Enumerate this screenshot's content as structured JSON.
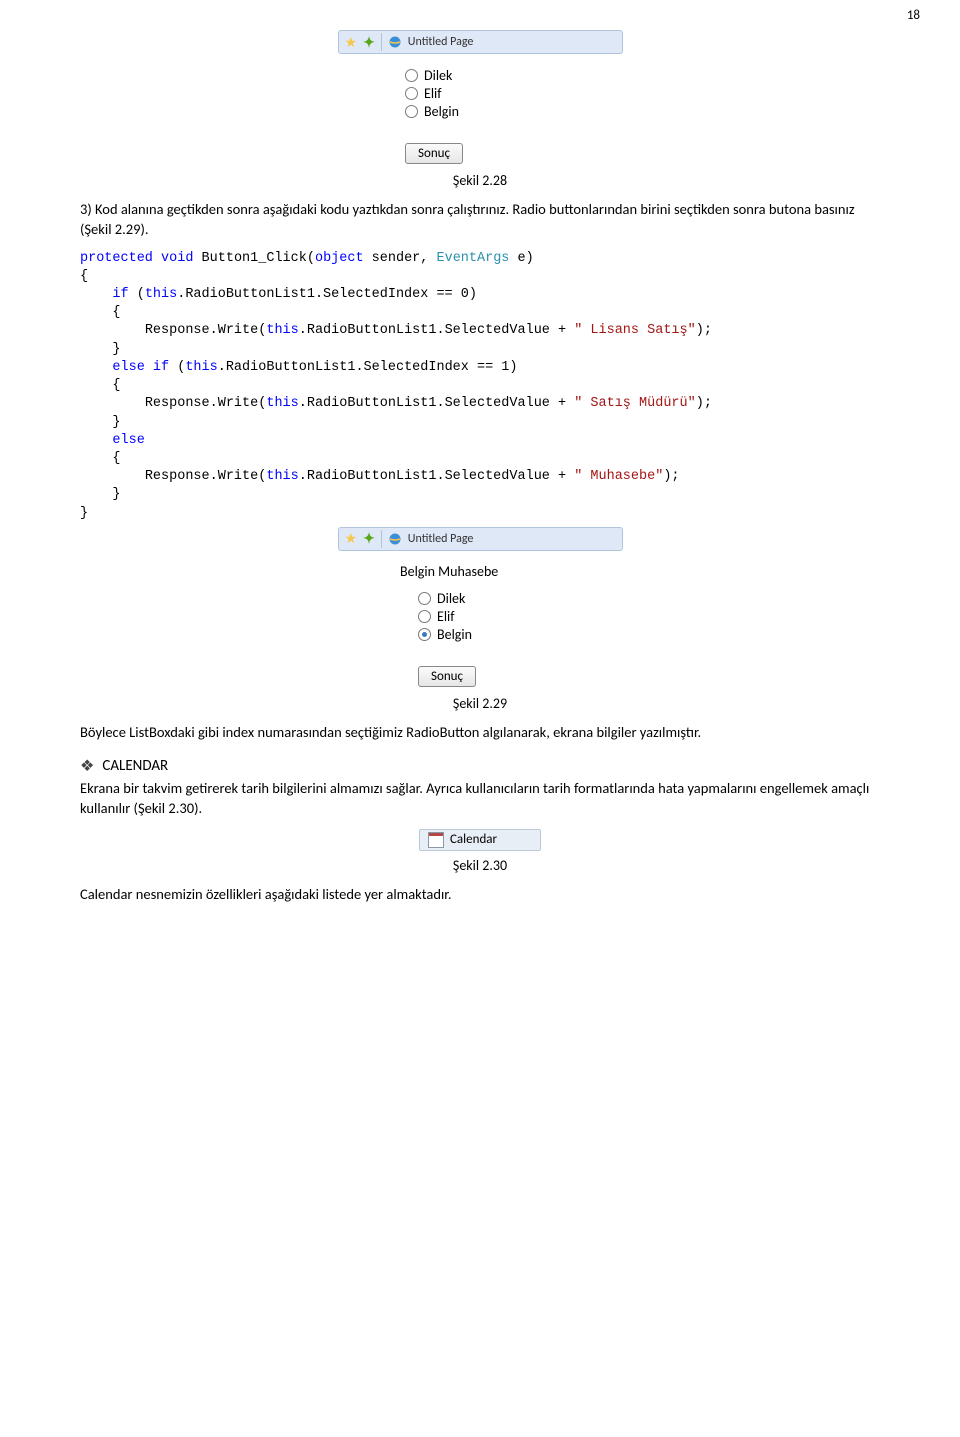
{
  "page_number": "18",
  "browser_tab_1": {
    "title": "Untitled Page"
  },
  "mini_app_1": {
    "options": [
      "Dilek",
      "Elif",
      "Belgin"
    ],
    "selected_index": -1,
    "button": "Sonuç"
  },
  "caption_1": "Şekil 2.28",
  "para_1": "3) Kod alanına geçtikden sonra aşağıdaki kodu yaztıkdan sonra çalıştırınız. Radio buttonlarından birini seçtikden sonra butona basınız (Şekil 2.29).",
  "code": {
    "l1a": "protected",
    "l1b": "void",
    "l1c": " Button1_Click(",
    "l1d": "object",
    "l1e": " sender, ",
    "l1f": "EventArgs",
    "l1g": " e)",
    "l2": "{",
    "l3a": "    if",
    "l3b": " (",
    "l3c": "this",
    "l3d": ".RadioButtonList1.SelectedIndex == 0)",
    "l4": "    {",
    "l5a": "        Response.Write(",
    "l5b": "this",
    "l5c": ".RadioButtonList1.SelectedValue + ",
    "l5d": "\" Lisans Satış\"",
    "l5e": ");",
    "l6": "    }",
    "l7a": "    else",
    "l7b": " ",
    "l7c": "if",
    "l7d": " (",
    "l7e": "this",
    "l7f": ".RadioButtonList1.SelectedIndex == 1)",
    "l8": "    {",
    "l9a": "        Response.Write(",
    "l9b": "this",
    "l9c": ".RadioButtonList1.SelectedValue + ",
    "l9d": "\" Satış Müdürü\"",
    "l9e": ");",
    "l10": "    }",
    "l11a": "    else",
    "l12": "    {",
    "l13a": "        Response.Write(",
    "l13b": "this",
    "l13c": ".RadioButtonList1.SelectedValue + ",
    "l13d": "\" Muhasebe\"",
    "l13e": ");",
    "l14": "    }",
    "l15": "}"
  },
  "browser_tab_2": {
    "title": "Untitled Page"
  },
  "mini_app_2": {
    "result_text": "Belgin Muhasebe",
    "options": [
      "Dilek",
      "Elif",
      "Belgin"
    ],
    "selected_index": 2,
    "button": "Sonuç"
  },
  "caption_2": "Şekil 2.29",
  "para_2": "Böylece ListBoxdaki gibi index numarasından seçtiğimiz RadioButton algılanarak, ekrana bilgiler yazılmıştır.",
  "section_calendar": {
    "title": "CALENDAR",
    "para": "Ekrana bir takvim getirerek tarih bilgilerini almamızı sağlar. Ayrıca kullanıcıların tarih formatlarında hata yapmalarını engellemek amaçlı kullanılır (Şekil 2.30).",
    "badge_label": "Calendar"
  },
  "caption_3": "Şekil 2.30",
  "para_3": "Calendar nesnemizin özellikleri aşağıdaki listede yer almaktadır."
}
